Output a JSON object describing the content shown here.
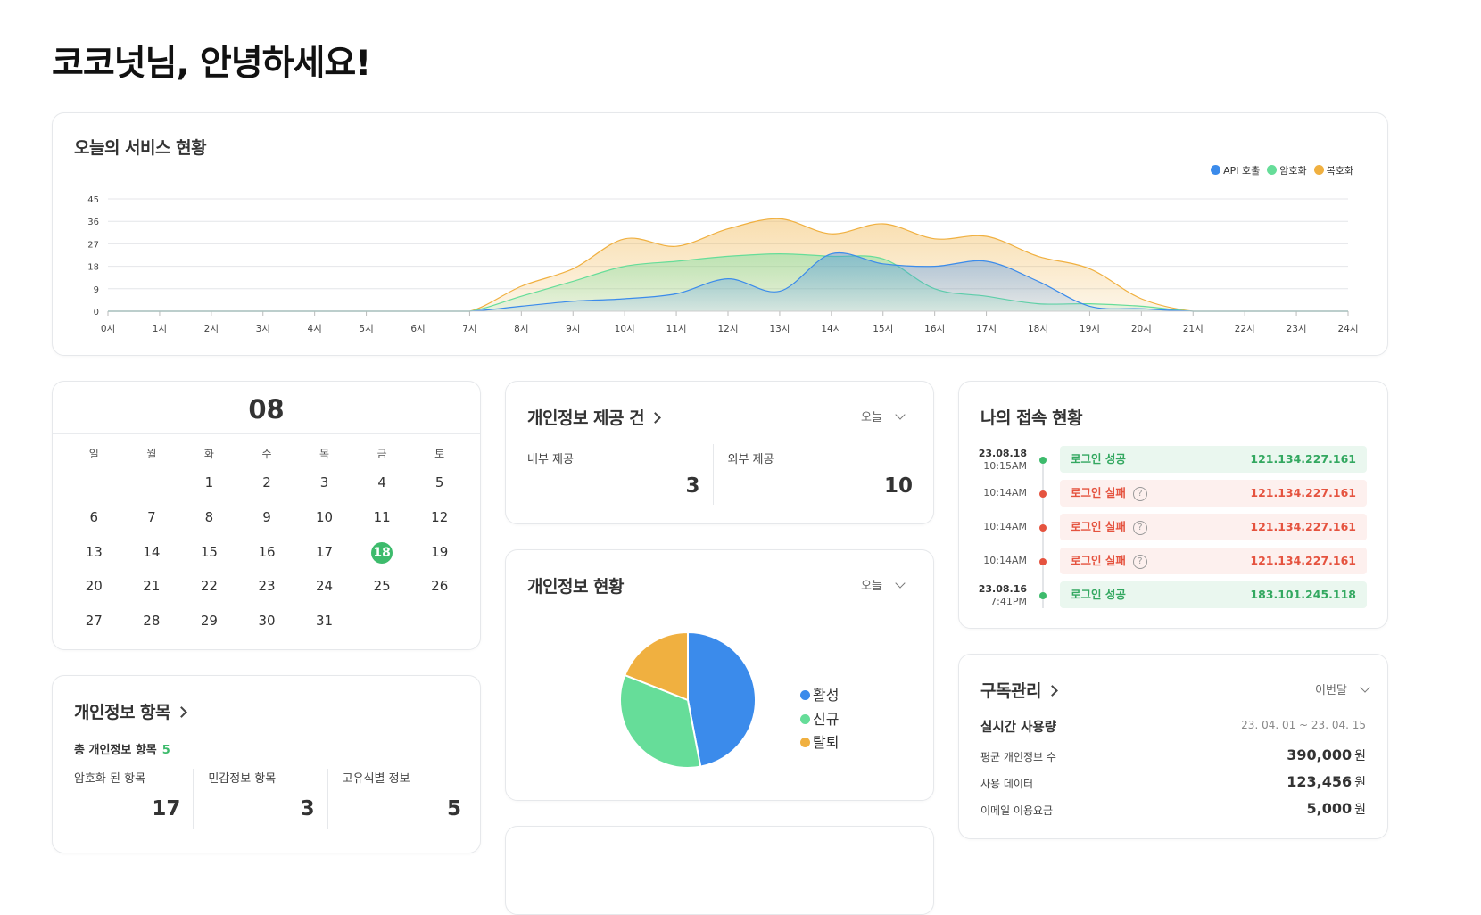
{
  "greeting": "코코넛님, 안녕하세요!",
  "service": {
    "title": "오늘의 서비스 현황",
    "legend": [
      {
        "name": "API 호출",
        "color": "#3b8beb"
      },
      {
        "name": "암호화",
        "color": "#66dd99"
      },
      {
        "name": "복호화",
        "color": "#f0b040"
      }
    ]
  },
  "chart_data": {
    "type": "area",
    "x": [
      "0시",
      "1시",
      "2시",
      "3시",
      "4시",
      "5시",
      "6시",
      "7시",
      "8시",
      "9시",
      "10시",
      "11시",
      "12시",
      "13시",
      "14시",
      "15시",
      "16시",
      "17시",
      "18시",
      "19시",
      "20시",
      "21시",
      "22시",
      "23시",
      "24시"
    ],
    "yticks": [
      0,
      9,
      18,
      27,
      36,
      45
    ],
    "ylim": [
      0,
      45
    ],
    "grid": true,
    "legend_position": "top-right",
    "series": [
      {
        "name": "복호화",
        "color": "#f0b040",
        "values": [
          0,
          0,
          0,
          0,
          0,
          0,
          0,
          0,
          10,
          17,
          29,
          26,
          33,
          37,
          31,
          35,
          29,
          30,
          22,
          17,
          5,
          0,
          0,
          0,
          0
        ]
      },
      {
        "name": "암호화",
        "color": "#66dd99",
        "values": [
          0,
          0,
          0,
          0,
          0,
          0,
          0,
          0,
          6,
          12,
          18,
          20,
          22,
          23,
          22,
          21,
          9,
          6,
          3,
          3,
          2,
          0,
          0,
          0,
          0
        ]
      },
      {
        "name": "API 호출",
        "color": "#3b8beb",
        "values": [
          0,
          0,
          0,
          0,
          0,
          0,
          0,
          0,
          2,
          4,
          5,
          7,
          13,
          8,
          23,
          19,
          18,
          20,
          12,
          2,
          1,
          0,
          0,
          0,
          0
        ]
      }
    ]
  },
  "calendar": {
    "month": "08",
    "weekdays": [
      "일",
      "월",
      "화",
      "수",
      "목",
      "금",
      "토"
    ],
    "days": [
      "",
      "",
      "1",
      "2",
      "3",
      "4",
      "5",
      "6",
      "7",
      "8",
      "9",
      "10",
      "11",
      "12",
      "13",
      "14",
      "15",
      "16",
      "17",
      "18",
      "19",
      "20",
      "21",
      "22",
      "23",
      "24",
      "25",
      "26",
      "27",
      "28",
      "29",
      "30",
      "31",
      "",
      ""
    ],
    "today": "18"
  },
  "pi_items": {
    "title": "개인정보 항목",
    "total_label": "총 개인정보 항목",
    "total": "5",
    "stats": [
      {
        "label": "암호화 된 항목",
        "value": "17"
      },
      {
        "label": "민감정보 항목",
        "value": "3"
      },
      {
        "label": "고유식별 정보",
        "value": "5"
      }
    ]
  },
  "provide": {
    "title": "개인정보 제공 건",
    "period": "오늘",
    "internal_label": "내부 제공",
    "internal": "3",
    "external_label": "외부 제공",
    "external": "10"
  },
  "pi_status": {
    "title": "개인정보 현황",
    "period": "오늘",
    "legend": [
      {
        "name": "활성",
        "color": "#3b8beb"
      },
      {
        "name": "신규",
        "color": "#66dd99"
      },
      {
        "name": "탈퇴",
        "color": "#f0b040"
      }
    ]
  },
  "pie_data": {
    "type": "pie",
    "slices": [
      {
        "name": "활성",
        "value": 47,
        "color": "#3b8beb"
      },
      {
        "name": "신규",
        "value": 34,
        "color": "#66dd99"
      },
      {
        "name": "탈퇴",
        "value": 19,
        "color": "#f0b040"
      }
    ]
  },
  "access": {
    "title": "나의 접속 현황",
    "logs": [
      {
        "date": "23.08.18",
        "time": "10:15AM",
        "status": "로그인 성공",
        "ip": "121.134.227.161",
        "ok": true
      },
      {
        "date": "",
        "time": "10:14AM",
        "status": "로그인 실패",
        "ip": "121.134.227.161",
        "ok": false
      },
      {
        "date": "",
        "time": "10:14AM",
        "status": "로그인 실패",
        "ip": "121.134.227.161",
        "ok": false
      },
      {
        "date": "",
        "time": "10:14AM",
        "status": "로그인 실패",
        "ip": "121.134.227.161",
        "ok": false
      },
      {
        "date": "23.08.16",
        "time": "7:41PM",
        "status": "로그인 성공",
        "ip": "183.101.245.118",
        "ok": true
      }
    ]
  },
  "subscription": {
    "title": "구독관리",
    "period": "이번달",
    "usage_label": "실시간 사용량",
    "range": "23. 04. 01 ~ 23. 04. 15",
    "unit": "원",
    "rows": [
      {
        "label": "평균 개인정보 수",
        "value": "390,000"
      },
      {
        "label": "사용 데이터",
        "value": "123,456"
      },
      {
        "label": "이메일 이용요금",
        "value": "5,000"
      }
    ]
  }
}
